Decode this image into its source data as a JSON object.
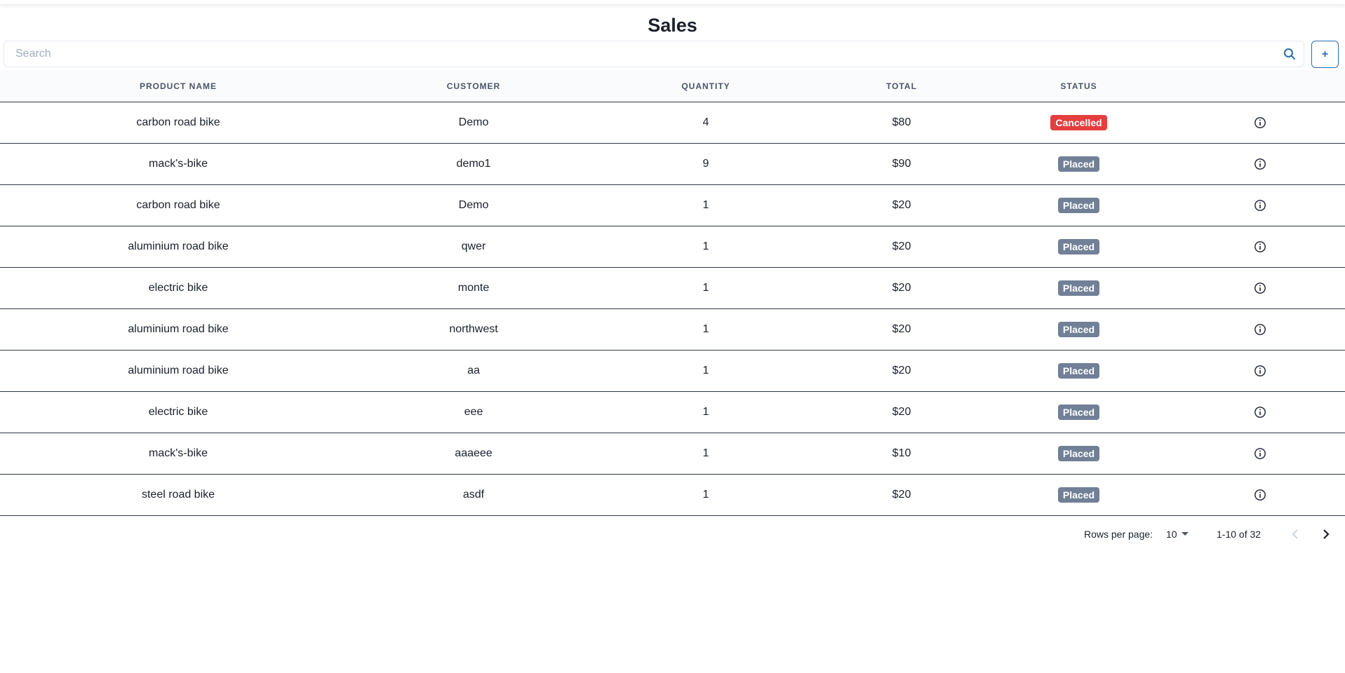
{
  "page": {
    "title": "Sales"
  },
  "search": {
    "placeholder": "Search",
    "value": ""
  },
  "toolbar": {
    "add_label": "+"
  },
  "table": {
    "columns": [
      "Product Name",
      "Customer",
      "Quantity",
      "Total",
      "Status"
    ],
    "rows": [
      {
        "product": "carbon road bike",
        "customer": "Demo",
        "quantity": "4",
        "total": "$80",
        "status": "Cancelled"
      },
      {
        "product": "mack's-bike",
        "customer": "demo1",
        "quantity": "9",
        "total": "$90",
        "status": "Placed"
      },
      {
        "product": "carbon road bike",
        "customer": "Demo",
        "quantity": "1",
        "total": "$20",
        "status": "Placed"
      },
      {
        "product": "aluminium road bike",
        "customer": "qwer",
        "quantity": "1",
        "total": "$20",
        "status": "Placed"
      },
      {
        "product": "electric bike",
        "customer": "monte",
        "quantity": "1",
        "total": "$20",
        "status": "Placed"
      },
      {
        "product": "aluminium road bike",
        "customer": "northwest",
        "quantity": "1",
        "total": "$20",
        "status": "Placed"
      },
      {
        "product": "aluminium road bike",
        "customer": "aa",
        "quantity": "1",
        "total": "$20",
        "status": "Placed"
      },
      {
        "product": "electric bike",
        "customer": "eee",
        "quantity": "1",
        "total": "$20",
        "status": "Placed"
      },
      {
        "product": "mack's-bike",
        "customer": "aaaeee",
        "quantity": "1",
        "total": "$10",
        "status": "Placed"
      },
      {
        "product": "steel road bike",
        "customer": "asdf",
        "quantity": "1",
        "total": "$20",
        "status": "Placed"
      }
    ]
  },
  "pagination": {
    "rows_per_page_label": "Rows per page:",
    "rows_per_page_value": "10",
    "range_text": "1-10 of 32"
  },
  "icons": {
    "search": "search-icon",
    "info": "info-icon",
    "dropdown": "caret-down-icon",
    "prev": "chevron-left-icon",
    "next": "chevron-right-icon"
  },
  "colors": {
    "accent": "#2b6cb0",
    "status_placed": "#718096",
    "status_cancelled": "#e53e3e"
  }
}
